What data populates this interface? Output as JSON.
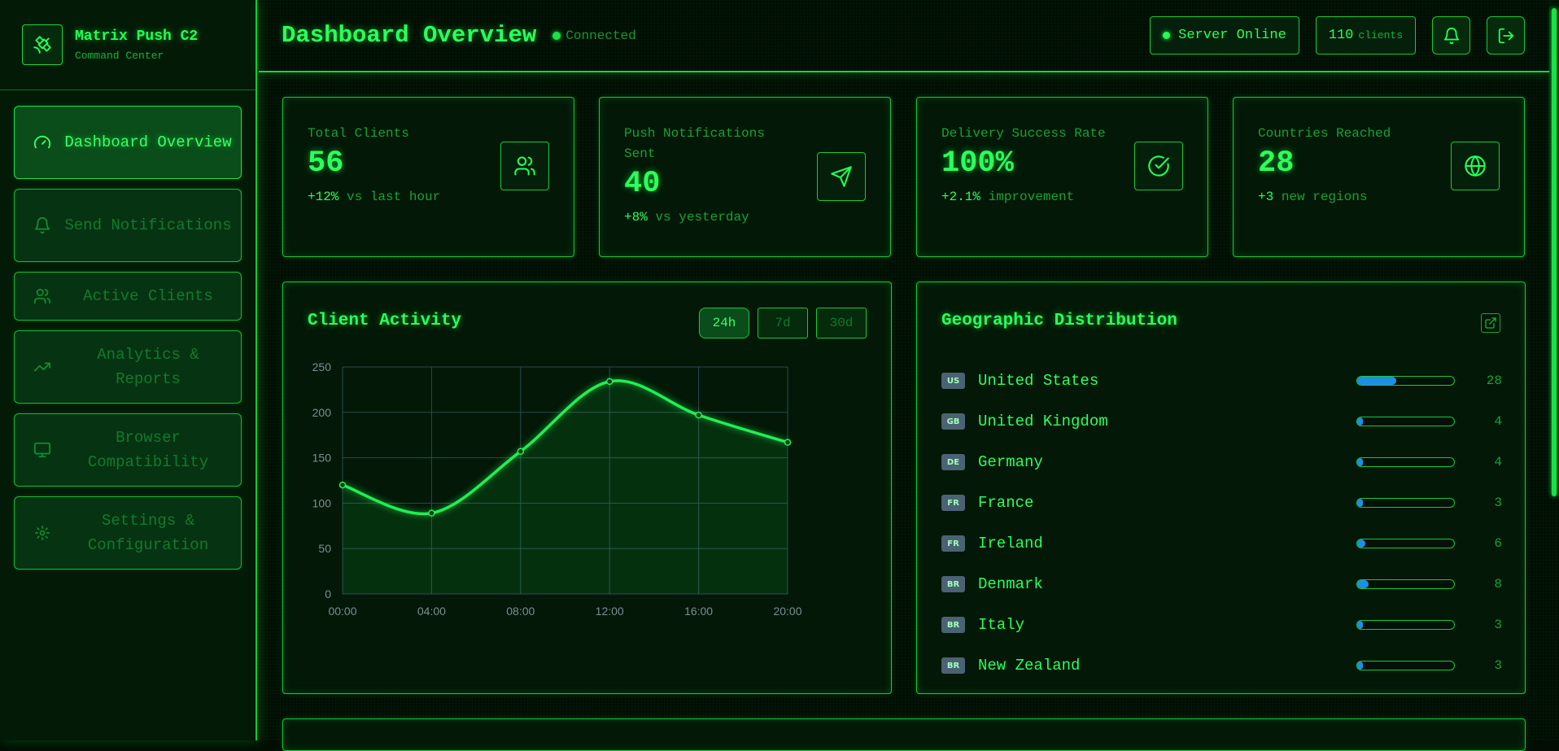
{
  "brand": {
    "title": "Matrix Push C2",
    "subtitle": "Command Center"
  },
  "sidebar": {
    "items": [
      {
        "label": "Dashboard Overview",
        "icon": "gauge-icon",
        "active": true
      },
      {
        "label": "Send Notifications",
        "icon": "bell-icon",
        "active": false
      },
      {
        "label": "Active Clients",
        "icon": "users-icon",
        "active": false
      },
      {
        "label": "Analytics & Reports",
        "icon": "trending-up-icon",
        "active": false
      },
      {
        "label": "Browser Compatibility",
        "icon": "monitor-icon",
        "active": false
      },
      {
        "label": "Settings & Configuration",
        "icon": "gear-icon",
        "active": false
      }
    ]
  },
  "header": {
    "title": "Dashboard Overview",
    "connection": "Connected",
    "server_status": "Server Online",
    "clients_count": "110",
    "clients_label": "clients"
  },
  "stats": [
    {
      "label": "Total Clients",
      "value": "56",
      "delta": "+12%",
      "delta_text": "vs last hour",
      "icon": "users-icon"
    },
    {
      "label": "Push Notifications Sent",
      "value": "40",
      "delta": "+8%",
      "delta_text": "vs yesterday",
      "icon": "send-icon"
    },
    {
      "label": "Delivery Success Rate",
      "value": "100%",
      "delta": "+2.1%",
      "delta_text": "improvement",
      "icon": "check-circle-icon"
    },
    {
      "label": "Countries Reached",
      "value": "28",
      "delta": "+3",
      "delta_text": "new regions",
      "icon": "globe-icon"
    }
  ],
  "activity": {
    "title": "Client Activity",
    "ranges": [
      "24h",
      "7d",
      "30d"
    ],
    "active_range": "24h"
  },
  "chart_data": {
    "type": "line",
    "x": [
      "00:00",
      "04:00",
      "08:00",
      "12:00",
      "16:00",
      "20:00"
    ],
    "series": [
      {
        "values": [
          120,
          89,
          157,
          234,
          197,
          167
        ]
      }
    ],
    "ylim": [
      0,
      250
    ],
    "yticks": [
      0,
      50,
      100,
      150,
      200,
      250
    ],
    "grid": true,
    "fill": true,
    "color": "#22ee55"
  },
  "geo": {
    "title": "Geographic Distribution",
    "max": 70,
    "rows": [
      {
        "code": "US",
        "name": "United States",
        "count": 28
      },
      {
        "code": "GB",
        "name": "United Kingdom",
        "count": 4
      },
      {
        "code": "DE",
        "name": "Germany",
        "count": 4
      },
      {
        "code": "FR",
        "name": "France",
        "count": 3
      },
      {
        "code": "FR",
        "name": "Ireland",
        "count": 6
      },
      {
        "code": "BR",
        "name": "Denmark",
        "count": 8
      },
      {
        "code": "BR",
        "name": "Italy",
        "count": 3
      },
      {
        "code": "BR",
        "name": "New Zealand",
        "count": 3
      }
    ]
  },
  "colors": {
    "accent": "#22ff55",
    "bar": "#1f8fe6",
    "background": "#020e04"
  }
}
